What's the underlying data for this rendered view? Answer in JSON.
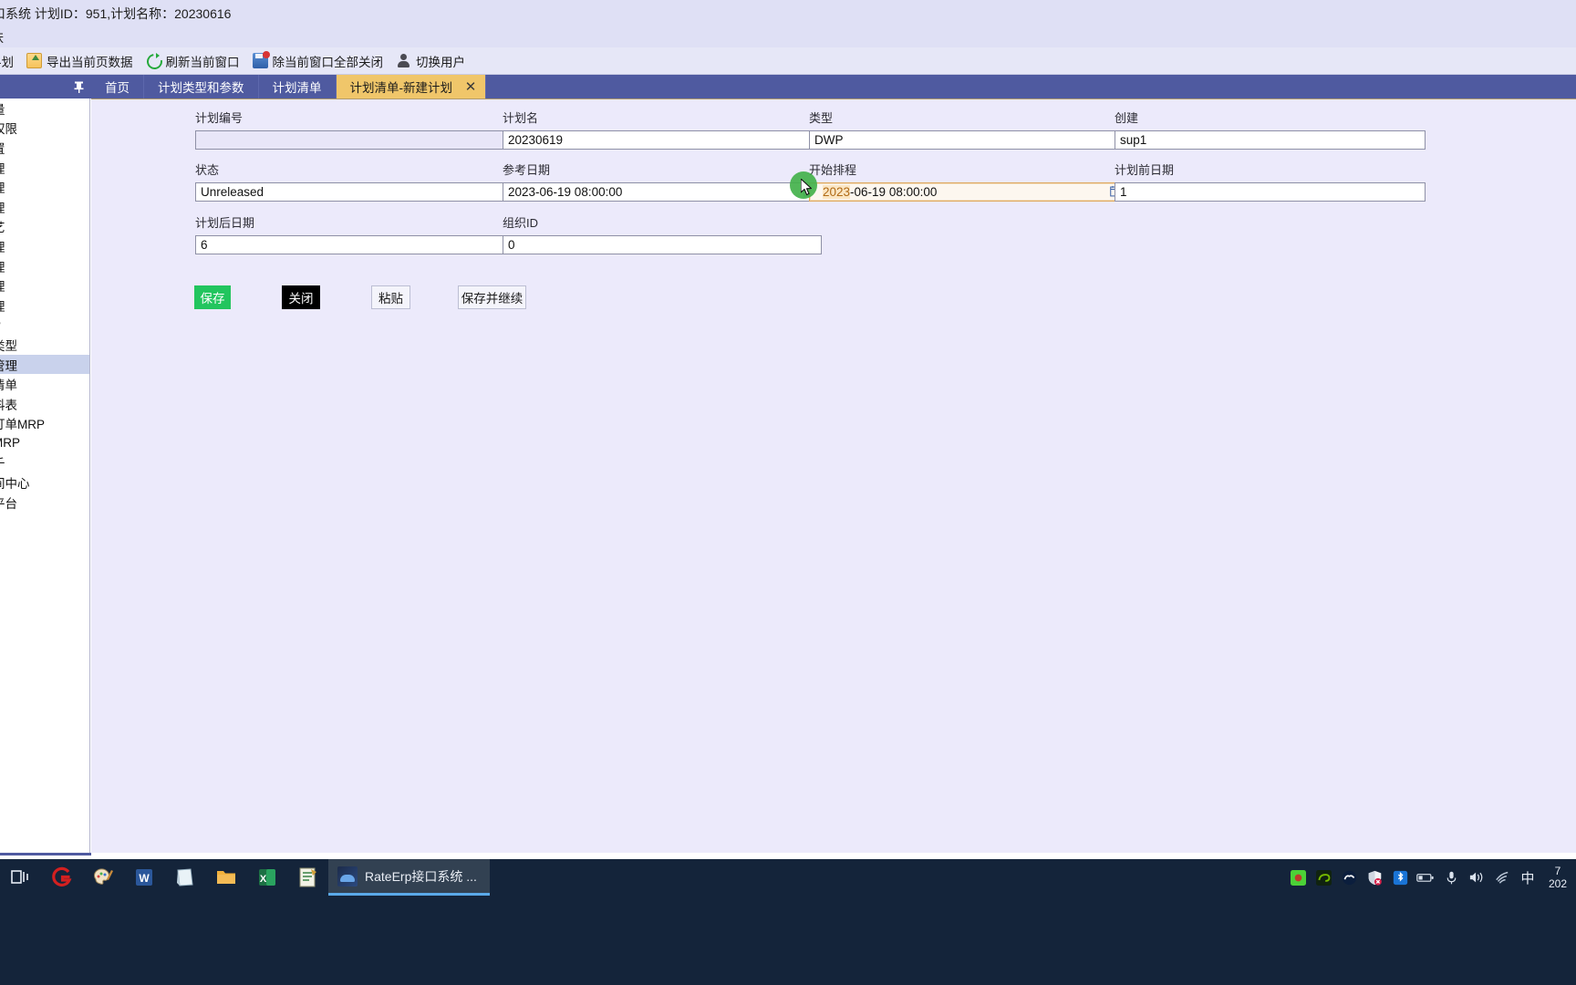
{
  "window": {
    "title": "口系统 计划ID：951,计划名称：20230616",
    "skin_label": "肤"
  },
  "toolbar": {
    "items": [
      {
        "label": "-划",
        "icon": "plan-icon"
      },
      {
        "label": "导出当前页数据",
        "icon": "export-icon"
      },
      {
        "label": "刷新当前窗口",
        "icon": "refresh-icon"
      },
      {
        "label": "除当前窗口全部关闭",
        "icon": "save-close-icon"
      },
      {
        "label": "切换用户",
        "icon": "user-icon"
      }
    ]
  },
  "tabs": {
    "pin_icon": "pin-icon",
    "items": [
      {
        "label": "首页",
        "active": false,
        "closable": false
      },
      {
        "label": "计划类型和参数",
        "active": false,
        "closable": false
      },
      {
        "label": "计划清单",
        "active": false,
        "closable": false
      },
      {
        "label": "计划清单-新建计划",
        "active": true,
        "closable": true
      }
    ],
    "close_glyph": "✕"
  },
  "sidebar": {
    "items": [
      {
        "label": "量",
        "selected": false
      },
      {
        "label": "权限",
        "selected": false
      },
      {
        "label": "置",
        "selected": false
      },
      {
        "label": "理",
        "selected": false
      },
      {
        "label": "理",
        "selected": false
      },
      {
        "label": "理",
        "selected": false
      },
      {
        "label": "艺",
        "selected": false
      },
      {
        "label": "理",
        "selected": false
      },
      {
        "label": "理",
        "selected": false
      },
      {
        "label": "理",
        "selected": false
      },
      {
        "label": "理",
        "selected": false
      },
      {
        "label": "P",
        "selected": false
      },
      {
        "label": "类型",
        "selected": false
      },
      {
        "label": "管理",
        "selected": true
      },
      {
        "label": "清单",
        "selected": false
      },
      {
        "label": "料表",
        "selected": false
      },
      {
        "label": "订单MRP",
        "selected": false
      },
      {
        "label": "MRP",
        "selected": false
      },
      {
        "label": "千",
        "selected": false
      },
      {
        "label": "间中心",
        "selected": false
      },
      {
        "label": "平台",
        "selected": false
      }
    ]
  },
  "form": {
    "fields": [
      {
        "name": "plan-code",
        "label": "计划编号",
        "value": "",
        "type": "text",
        "state": "empty"
      },
      {
        "name": "plan-name",
        "label": "计划名",
        "value": "20230619",
        "type": "text",
        "state": "normal"
      },
      {
        "name": "plan-type",
        "label": "类型",
        "value": "DWP",
        "type": "select",
        "state": "normal"
      },
      {
        "name": "created-by",
        "label": "创建",
        "value": "sup1",
        "type": "text",
        "state": "normal"
      },
      {
        "name": "status",
        "label": "状态",
        "value": "Unreleased",
        "type": "text",
        "state": "normal"
      },
      {
        "name": "reference-date",
        "label": "参考日期",
        "value": "2023-06-19 08:00:00",
        "type": "date",
        "state": "normal"
      },
      {
        "name": "start-schedule",
        "label": "开始排程",
        "value": "2023-06-19 08:00:00",
        "type": "date",
        "state": "focused",
        "selected_part": "2023",
        "rest_part": "-06-19 08:00:00"
      },
      {
        "name": "days-before",
        "label": "计划前日期",
        "value": "1",
        "type": "text",
        "state": "normal"
      },
      {
        "name": "days-after",
        "label": "计划后日期",
        "value": "6",
        "type": "text",
        "state": "normal"
      },
      {
        "name": "org-id",
        "label": "组织ID",
        "value": "0",
        "type": "text",
        "state": "normal"
      }
    ],
    "type_options": [
      "DWP"
    ],
    "buttons": {
      "save": "保存",
      "close": "关闭",
      "paste": "粘贴",
      "save_continue": "保存并继续"
    }
  },
  "taskbar": {
    "icons": [
      "task-view-icon",
      "qq-browser-icon",
      "paint-icon",
      "word-icon",
      "onenote-icon",
      "file-explorer-icon",
      "excel-icon",
      "notepad-plus-icon"
    ],
    "active_window": {
      "label": "RateErp接口系统 ...",
      "icon": "rateerp-icon"
    },
    "tray_icons": [
      "nvidia-green-icon",
      "nvidia-icon",
      "weixin-icon",
      "defender-icon",
      "bluetooth-icon",
      "battery-icon",
      "microphone-icon",
      "volume-icon",
      "wifi-icon"
    ],
    "ime_label": "中",
    "clock_line1": "7",
    "clock_line2": "202"
  },
  "colors": {
    "accent_tab": "#f0c66a",
    "tabstrip": "#4f5aa0",
    "panel_bg": "#eceafb",
    "save_green": "#22c55e",
    "focus_border": "#e0a85a",
    "selection_bg": "#fbe6c3",
    "selection_fg": "#b06a16",
    "sidebar_selected": "#c9d2ec",
    "taskbar_bg": "#14243a"
  }
}
